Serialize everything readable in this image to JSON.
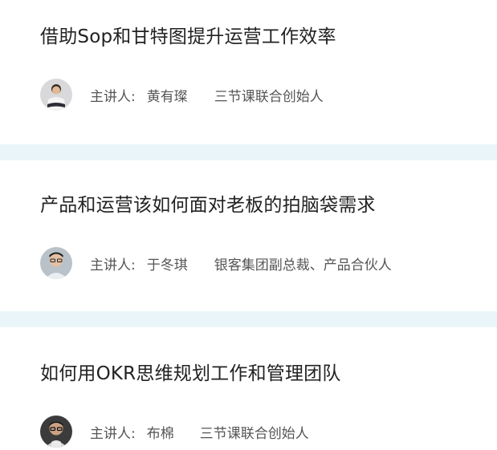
{
  "courses": [
    {
      "title": "借助Sop和甘特图提升运营工作效率",
      "speaker_label": "主讲人:",
      "speaker_name": "黄有璨",
      "speaker_role": "三节课联合创始人",
      "avatar_icon": "avatar-person-sitting"
    },
    {
      "title": "产品和运营该如何面对老板的拍脑袋需求",
      "speaker_label": "主讲人:",
      "speaker_name": "于冬琪",
      "speaker_role": "银客集团副总裁、产品合伙人",
      "avatar_icon": "avatar-person-glasses"
    },
    {
      "title": "如何用OKR思维规划工作和管理团队",
      "speaker_label": "主讲人:",
      "speaker_name": "布棉",
      "speaker_role": "三节课联合创始人",
      "avatar_icon": "avatar-person-glasses-dark"
    }
  ],
  "colors": {
    "divider": "#eaf5f9",
    "title_text": "#222222",
    "meta_text": "#555555"
  }
}
